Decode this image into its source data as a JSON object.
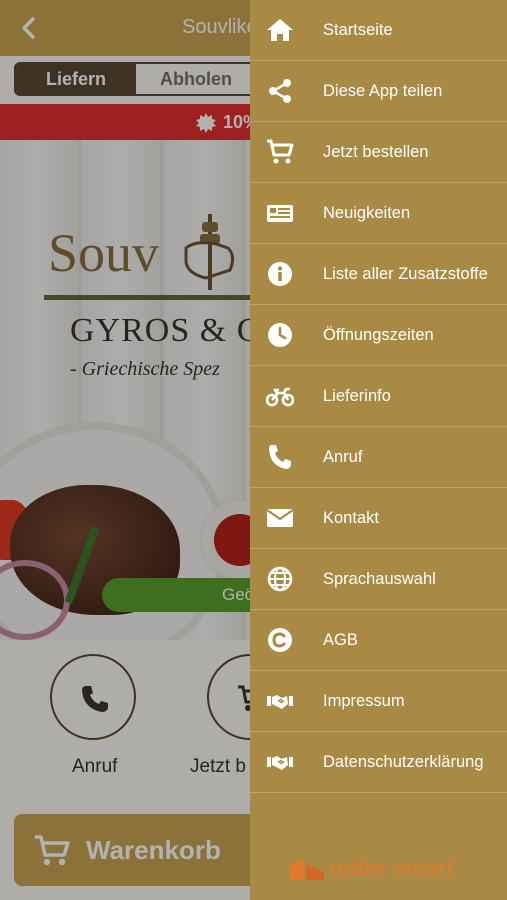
{
  "app": {
    "title": "Souvlike",
    "segment": {
      "active": "Liefern",
      "inactive": "Abholen"
    },
    "promo": {
      "text": "10%"
    },
    "hero": {
      "logo": "Souv",
      "subtitle": "GYROS & G",
      "tagline": "- Griechische Spez",
      "open_status": "Geö"
    },
    "actions": [
      {
        "label": "Anruf",
        "icon": "phone-icon"
      },
      {
        "label": "Jetzt b",
        "icon": "cart-icon"
      }
    ],
    "cart_button": "Warenkorb"
  },
  "drawer": {
    "items": [
      {
        "label": "Startseite",
        "icon": "home-icon"
      },
      {
        "label": "Diese App teilen",
        "icon": "share-icon"
      },
      {
        "label": "Jetzt bestellen",
        "icon": "cart-icon"
      },
      {
        "label": "Neuigkeiten",
        "icon": "news-icon"
      },
      {
        "label": "Liste aller Zusatzstoffe",
        "icon": "info-icon"
      },
      {
        "label": "Öffnungszeiten",
        "icon": "clock-icon"
      },
      {
        "label": "Lieferinfo",
        "icon": "motorcycle-icon"
      },
      {
        "label": "Anruf",
        "icon": "phone-icon"
      },
      {
        "label": "Kontakt",
        "icon": "envelope-icon"
      },
      {
        "label": "Sprachauswahl",
        "icon": "globe-icon"
      },
      {
        "label": "AGB",
        "icon": "copyright-icon"
      },
      {
        "label": "Impressum",
        "icon": "handshake-icon"
      },
      {
        "label": "Datenschutzerklärung",
        "icon": "handshake-icon"
      }
    ],
    "brand": "order smart"
  },
  "colors": {
    "header": "#c9a451",
    "drawer": "#a88a45",
    "promo": "#e22f2f",
    "open_status": "#5aa02c",
    "brand_orange": "#e07a2a"
  }
}
